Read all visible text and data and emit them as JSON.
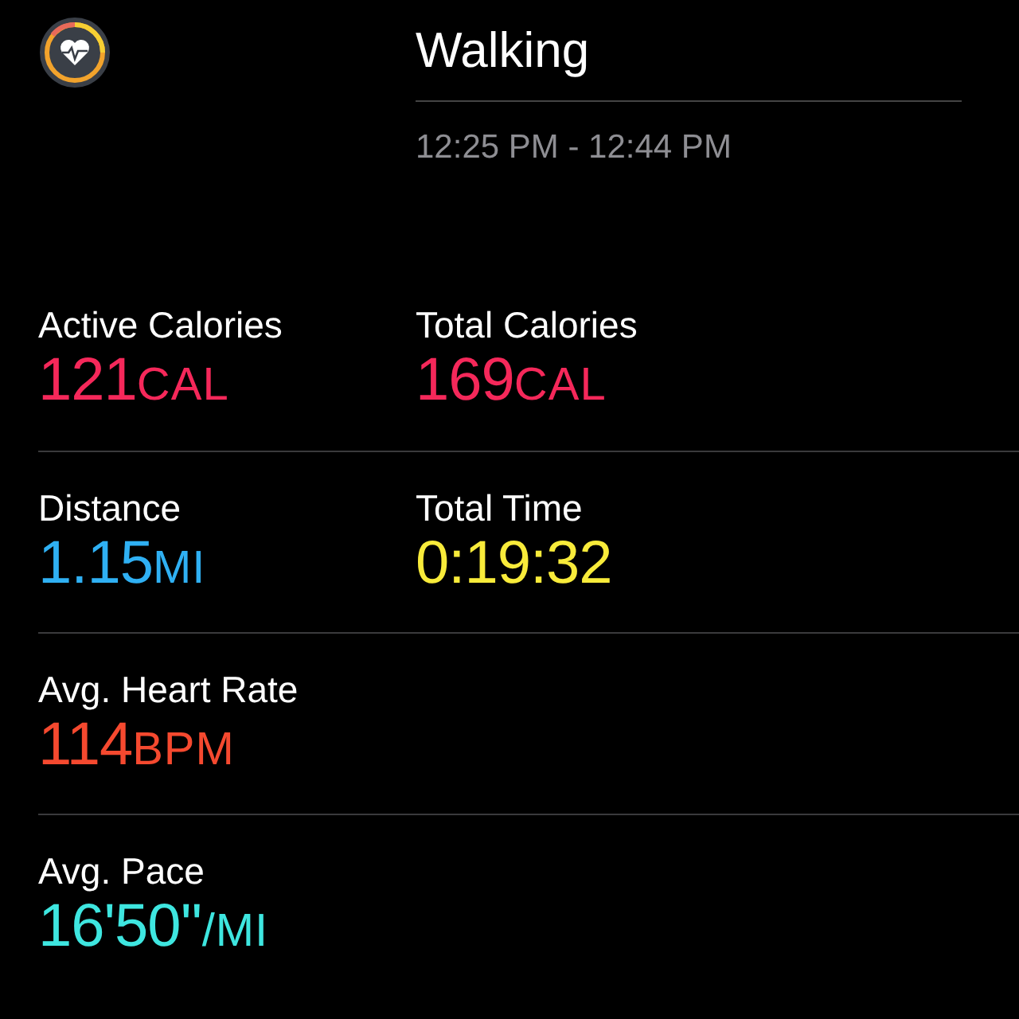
{
  "workout": {
    "title": "Walking",
    "time_range": "12:25 PM - 12:44 PM"
  },
  "rows": [
    {
      "metrics": [
        {
          "label": "Active Calories",
          "value": "121",
          "unit": "CAL",
          "color": "#f5285a"
        },
        {
          "label": "Total Calories",
          "value": "169",
          "unit": "CAL",
          "color": "#f5285a"
        }
      ]
    },
    {
      "metrics": [
        {
          "label": "Distance",
          "value": "1.15",
          "unit": "MI",
          "color": "#2fb0f3"
        },
        {
          "label": "Total Time",
          "value": "0:19:32",
          "color": "#f8eb3a"
        }
      ]
    },
    {
      "metrics": [
        {
          "label": "Avg. Heart Rate",
          "value": "114",
          "unit": "BPM",
          "color": "#f5492f"
        }
      ]
    },
    {
      "metrics": [
        {
          "label": "Avg. Pace",
          "value": "16'50''",
          "unit": "/MI",
          "color": "#3ee6e0"
        }
      ]
    }
  ]
}
